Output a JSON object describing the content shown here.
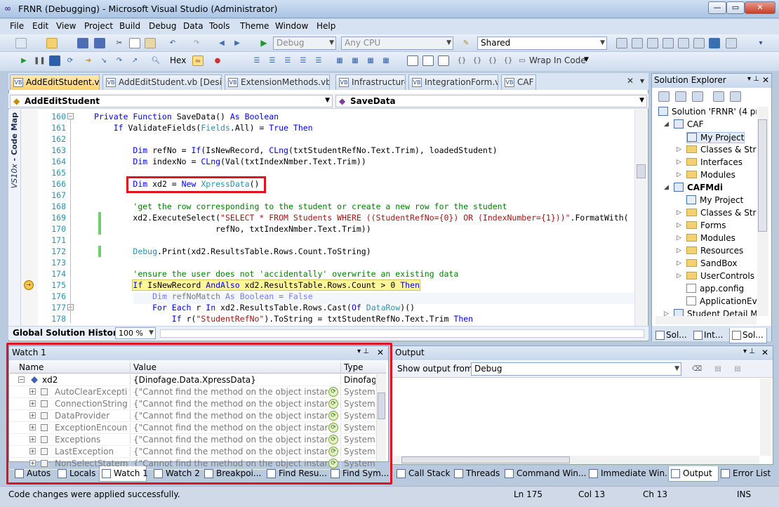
{
  "window": {
    "title": "FRNR (Debugging) - Microsoft Visual Studio (Administrator)"
  },
  "menu": [
    "File",
    "Edit",
    "View",
    "Project",
    "Build",
    "Debug",
    "Data",
    "Tools",
    "Theme",
    "Window",
    "Help"
  ],
  "toolbar": {
    "config": "Debug",
    "platform": "Any CPU",
    "shared": "Shared",
    "hex": "Hex",
    "wrap": "Wrap In Code"
  },
  "doc_tabs": [
    {
      "label": "AddEditStudent.vb",
      "active": true
    },
    {
      "label": "AddEditStudent.vb [Design]",
      "active": false
    },
    {
      "label": "ExtensionMethods.vb",
      "active": false
    },
    {
      "label": "Infrastructure.vb",
      "active": false
    },
    {
      "label": "IntegrationForm.vb",
      "active": false
    },
    {
      "label": "CAF",
      "active": false
    }
  ],
  "nav": {
    "left": "AddEditStudent",
    "right": "SaveData"
  },
  "codemap": {
    "prefix": "VS10x",
    "label": "Code Map"
  },
  "code": {
    "lines": [
      {
        "n": "160",
        "html": "<span class=\"kw\">Private Function</span> SaveData() <span class=\"kw\">As Boolean</span>"
      },
      {
        "n": "161",
        "html": "    <span class=\"kw\">If</span> ValidateFields(<span class=\"ty\">Fields</span>.All) = <span class=\"kw\">True Then</span>"
      },
      {
        "n": "162",
        "html": ""
      },
      {
        "n": "163",
        "html": "        <span class=\"kw\">Dim</span> refNo = <span class=\"kw\">If</span>(IsNewRecord, <span class=\"kw\">CLng</span>(txtStudentRefNo.Text.Trim), loadedStudent)"
      },
      {
        "n": "164",
        "html": "        <span class=\"kw\">Dim</span> indexNo = <span class=\"kw\">CLng</span>(Val(txtIndexNmber.Text.Trim))"
      },
      {
        "n": "165",
        "html": ""
      },
      {
        "n": "166",
        "html": "        <span class=\"kw\">Dim</span> xd2 = <span class=\"kw\">New</span> <span class=\"ty\">XpressData</span>()"
      },
      {
        "n": "167",
        "html": ""
      },
      {
        "n": "168",
        "html": "        <span class=\"cm\">'get the row corresponding to the student or create a new row for the student</span>"
      },
      {
        "n": "169",
        "html": "        xd2.ExecuteSelect(<span class=\"st\">\"SELECT * FROM Students WHERE ((StudentRefNo={0}) OR (IndexNumber={1}))\"</span>.FormatWith("
      },
      {
        "n": "170",
        "html": "                         refNo, txtIndexNmber.Text.Trim))"
      },
      {
        "n": "171",
        "html": ""
      },
      {
        "n": "172",
        "html": "        <span class=\"ty\">Debug</span>.Print(xd2.ResultsTable.Rows.Count.ToString)"
      },
      {
        "n": "173",
        "html": ""
      },
      {
        "n": "174",
        "html": "        <span class=\"cm\">'ensure the user does not 'accidentally' overwrite an existing data</span>"
      },
      {
        "n": "175",
        "html": "        <span style=\"background:#fff79a;outline:1px solid #d2c85a\"><span class=\"kw\">If</span> IsNewRecord <span class=\"kw\">AndAlso</span> xd2.ResultsTable.Rows.Count &gt; 0 <span class=\"kw\">Then</span></span>"
      },
      {
        "n": "176",
        "html": "            <span class=\"kw\">Dim</span> refNoMatch <span class=\"kw\">As Boolean</span> = <span class=\"kw\">False</span>"
      },
      {
        "n": "177",
        "html": "            <span class=\"kw\">For Each</span> r <span class=\"kw\">In</span> xd2.ResultsTable.Rows.Cast(<span class=\"kw\">Of</span> <span class=\"ty\">DataRow</span>)()"
      },
      {
        "n": "178",
        "html": "                <span class=\"kw\">If</span> r(<span class=\"st\">\"StudentRefNo\"</span>).ToString = txtStudentRefNo.Text.Trim <span class=\"kw\">Then</span>"
      }
    ]
  },
  "editor_bottom": {
    "history": "Global Solution History",
    "zoom": "100 %"
  },
  "solution_explorer": {
    "title": "Solution Explorer",
    "items": [
      {
        "label": "Solution 'FRNR' (4 pro",
        "kind": "sln",
        "indent": 0,
        "bold": false
      },
      {
        "label": "CAF",
        "kind": "proj",
        "indent": 1,
        "bold": false,
        "exp": "◢"
      },
      {
        "label": "My Project",
        "kind": "mp",
        "indent": 2,
        "bold": false,
        "sel": true
      },
      {
        "label": "Classes & Struc",
        "kind": "folder",
        "indent": 2,
        "bold": false,
        "exp": "▷"
      },
      {
        "label": "Interfaces",
        "kind": "folder",
        "indent": 2,
        "bold": false,
        "exp": "▷"
      },
      {
        "label": "Modules",
        "kind": "folder",
        "indent": 2,
        "bold": false,
        "exp": "▷"
      },
      {
        "label": "CAFMdi",
        "kind": "proj",
        "indent": 1,
        "bold": true,
        "exp": "◢"
      },
      {
        "label": "My Project",
        "kind": "mp",
        "indent": 2,
        "bold": false
      },
      {
        "label": "Classes & Struc",
        "kind": "folder",
        "indent": 2,
        "bold": false,
        "exp": "▷"
      },
      {
        "label": "Forms",
        "kind": "folder",
        "indent": 2,
        "bold": false,
        "exp": "▷"
      },
      {
        "label": "Modules",
        "kind": "folder",
        "indent": 2,
        "bold": false,
        "exp": "▷"
      },
      {
        "label": "Resources",
        "kind": "folder",
        "indent": 2,
        "bold": false,
        "exp": "▷"
      },
      {
        "label": "SandBox",
        "kind": "folder",
        "indent": 2,
        "bold": false,
        "exp": "▷"
      },
      {
        "label": "UserControls",
        "kind": "folder",
        "indent": 2,
        "bold": false,
        "exp": "▷"
      },
      {
        "label": "app.config",
        "kind": "file",
        "indent": 2,
        "bold": false
      },
      {
        "label": "ApplicationEve",
        "kind": "file",
        "indent": 2,
        "bold": false
      },
      {
        "label": "Student Detail Mo",
        "kind": "proj",
        "indent": 1,
        "bold": false,
        "exp": "▷"
      }
    ],
    "bottom_tabs": [
      "Sol...",
      "Int...",
      "Sol..."
    ]
  },
  "watch": {
    "title": "Watch 1",
    "columns": [
      "Name",
      "Value",
      "Type"
    ],
    "rows": [
      {
        "name": "xd2",
        "value": "{Dinofage.Data.XpressData}",
        "type": "Dinofage",
        "top": true
      },
      {
        "name": "AutoClearExceptio",
        "value": "{\"Cannot find the method on the object instance.\"}",
        "type": "System.A"
      },
      {
        "name": "ConnectionString",
        "value": "{\"Cannot find the method on the object instance.\"}",
        "type": "System.A"
      },
      {
        "name": "DataProvider",
        "value": "{\"Cannot find the method on the object instance.\"}",
        "type": "System.A"
      },
      {
        "name": "ExceptionEncounte",
        "value": "{\"Cannot find the method on the object instance.\"}",
        "type": "System.A"
      },
      {
        "name": "Exceptions",
        "value": "{\"Cannot find the method on the object instance.\"}",
        "type": "System.A"
      },
      {
        "name": "LastException",
        "value": "{\"Cannot find the method on the object instance.\"}",
        "type": "System.A"
      },
      {
        "name": "NonSelectStatemen",
        "value": "{\"Cannot find the method on the object instance.\"}",
        "type": "System.A"
      }
    ]
  },
  "output": {
    "title": "Output",
    "show_from_label": "Show output from:",
    "show_from_value": "Debug"
  },
  "bottom_tabs_left": [
    {
      "label": "Autos"
    },
    {
      "label": "Locals"
    },
    {
      "label": "Watch 1",
      "active": true
    },
    {
      "label": "Watch 2"
    },
    {
      "label": "Breakpoi..."
    },
    {
      "label": "Find Resu..."
    },
    {
      "label": "Find Sym..."
    }
  ],
  "bottom_tabs_right": [
    {
      "label": "Call Stack"
    },
    {
      "label": "Threads"
    },
    {
      "label": "Command Win..."
    },
    {
      "label": "Immediate Win..."
    },
    {
      "label": "Output",
      "active": true
    },
    {
      "label": "Error List"
    }
  ],
  "status": {
    "message": "Code changes were applied successfully.",
    "line": "Ln 175",
    "col": "Col 13",
    "ch": "Ch 13",
    "mode": "INS"
  },
  "colors": {
    "highlight_box": "#e0141e",
    "keyword": "#0000ff",
    "comment": "#008000",
    "string": "#a31515"
  }
}
